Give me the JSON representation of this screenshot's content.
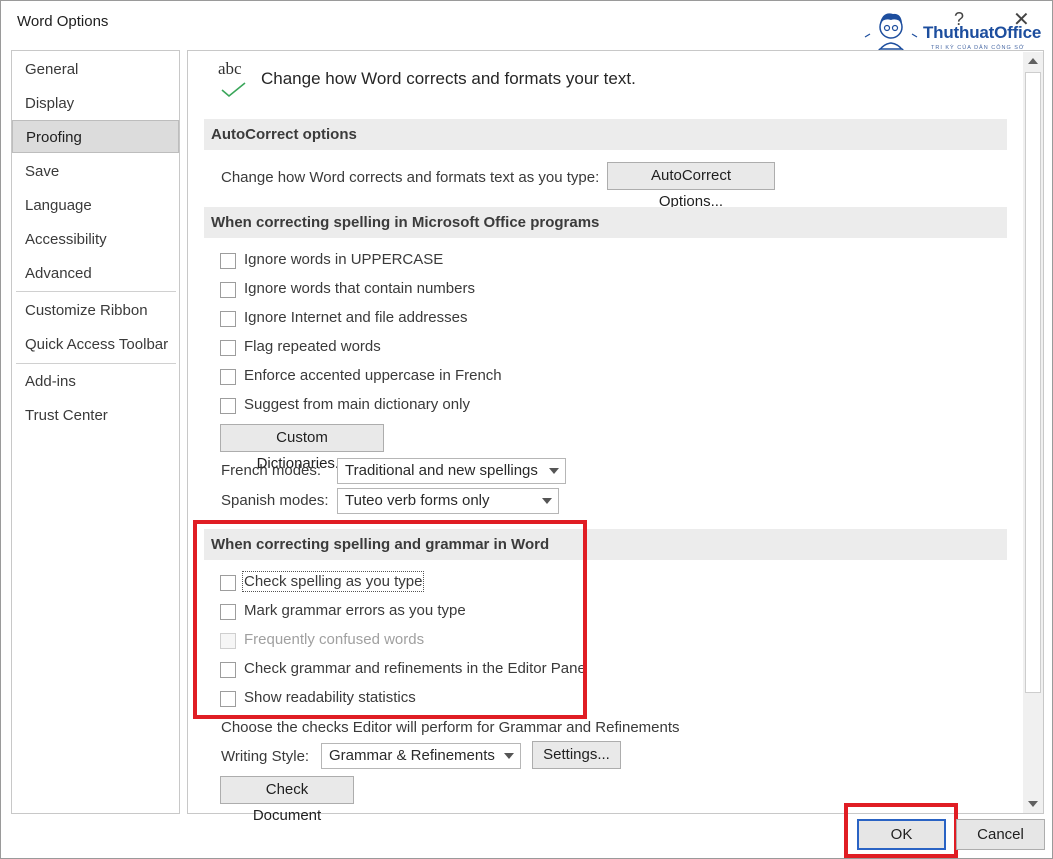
{
  "window": {
    "title": "Word Options",
    "help_label": "?",
    "close_label": "✕"
  },
  "logo": {
    "brand": "ThuthuatOffice",
    "tagline": "TRI KỲ CỦA DÂN CÔNG SỞ"
  },
  "sidebar": {
    "items": [
      {
        "label": "General"
      },
      {
        "label": "Display"
      },
      {
        "label": "Proofing",
        "selected": true
      },
      {
        "label": "Save"
      },
      {
        "label": "Language"
      },
      {
        "label": "Accessibility"
      },
      {
        "label": "Advanced"
      },
      {
        "label": "Customize Ribbon"
      },
      {
        "label": "Quick Access Toolbar"
      },
      {
        "label": "Add-ins"
      },
      {
        "label": "Trust Center"
      }
    ]
  },
  "header": {
    "icon_text": "abc",
    "text": "Change how Word corrects and formats your text."
  },
  "autocorrect": {
    "section_title": "AutoCorrect options",
    "description": "Change how Word corrects and formats text as you type:",
    "button_label": "AutoCorrect Options..."
  },
  "office_spelling": {
    "section_title": "When correcting spelling in Microsoft Office programs",
    "checkboxes": [
      {
        "label": "Ignore words in UPPERCASE",
        "checked": false
      },
      {
        "label": "Ignore words that contain numbers",
        "checked": false
      },
      {
        "label": "Ignore Internet and file addresses",
        "checked": false
      },
      {
        "label": "Flag repeated words",
        "checked": false
      },
      {
        "label": "Enforce accented uppercase in French",
        "checked": false
      },
      {
        "label": "Suggest from main dictionary only",
        "checked": false
      }
    ],
    "custom_dict_button": "Custom Dictionaries...",
    "french_modes_label": "French modes:",
    "french_modes_value": "Traditional and new spellings",
    "spanish_modes_label": "Spanish modes:",
    "spanish_modes_value": "Tuteo verb forms only"
  },
  "word_spelling": {
    "section_title": "When correcting spelling and grammar in Word",
    "checkboxes": [
      {
        "label": "Check spelling as you type",
        "checked": false
      },
      {
        "label": "Mark grammar errors as you type",
        "checked": false
      },
      {
        "label": "Frequently confused words",
        "checked": false,
        "disabled": true
      },
      {
        "label": "Check grammar and refinements in the Editor Pane",
        "checked": false
      },
      {
        "label": "Show readability statistics",
        "checked": false
      }
    ],
    "editor_description": "Choose the checks Editor will perform for Grammar and Refinements",
    "writing_style_label": "Writing Style:",
    "writing_style_value": "Grammar & Refinements",
    "settings_button": "Settings...",
    "check_document_button": "Check Document"
  },
  "footer": {
    "ok_label": "OK",
    "cancel_label": "Cancel"
  },
  "colors": {
    "highlight_red": "#e01d24",
    "ok_focus_blue": "#2a63c4",
    "section_bg": "#ececec",
    "selected_nav_bg": "#dcdcdc"
  }
}
